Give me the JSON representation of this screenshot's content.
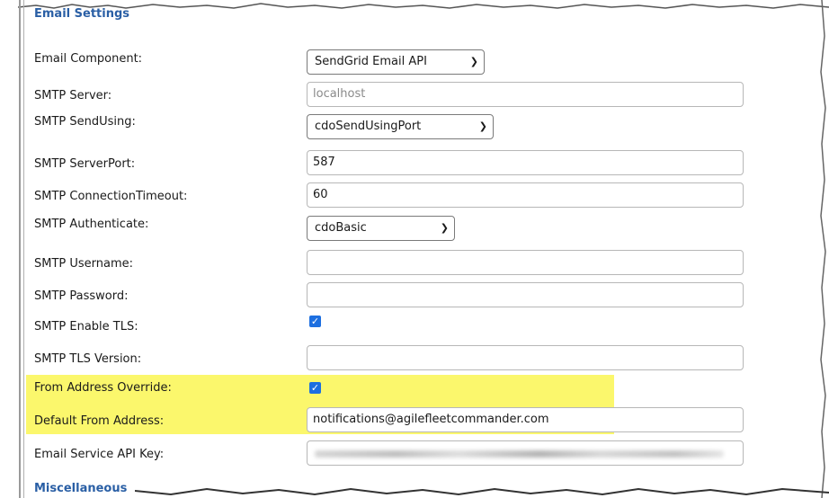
{
  "section_title": "Email Settings",
  "next_section_title": "Miscellaneous",
  "fields": {
    "email_component": {
      "label": "Email Component:",
      "value": "SendGrid Email API"
    },
    "smtp_server": {
      "label": "SMTP Server:",
      "placeholder": "localhost"
    },
    "smtp_sendusing": {
      "label": "SMTP SendUsing:",
      "value": "cdoSendUsingPort"
    },
    "smtp_serverport": {
      "label": "SMTP ServerPort:",
      "value": "587"
    },
    "smtp_timeout": {
      "label": "SMTP ConnectionTimeout:",
      "value": "60"
    },
    "smtp_authenticate": {
      "label": "SMTP Authenticate:",
      "value": "cdoBasic"
    },
    "smtp_username": {
      "label": "SMTP Username:",
      "value": ""
    },
    "smtp_password": {
      "label": "SMTP Password:",
      "value": ""
    },
    "smtp_enable_tls": {
      "label": "SMTP Enable TLS:",
      "checked": true
    },
    "smtp_tls_version": {
      "label": "SMTP TLS Version:",
      "value": ""
    },
    "from_override": {
      "label": "From Address Override:",
      "checked": true
    },
    "default_from": {
      "label": "Default From Address:",
      "value": "notifications@agilefleetcommander.com"
    },
    "api_key": {
      "label": "Email Service API Key:",
      "value": "(obscured)"
    }
  },
  "colors": {
    "section_title": "#2a5fa5",
    "highlight": "#fbf76c",
    "checkbox": "#1d6fe0"
  },
  "icons": {
    "caret": "chevron-down-icon",
    "check": "check-icon"
  }
}
